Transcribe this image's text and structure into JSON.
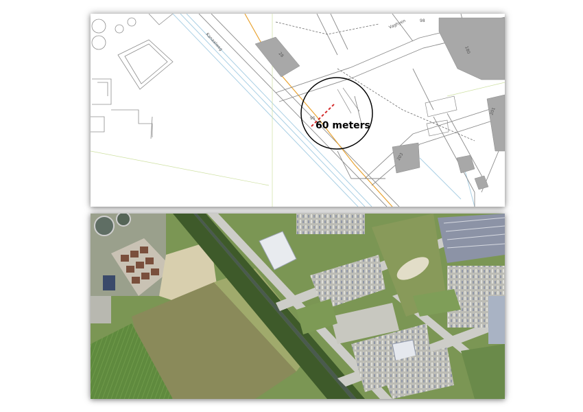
{
  "map": {
    "street_labels": {
      "kanaalweg": "Kanaalweg",
      "vaghyen": "Vaghyen"
    },
    "building_numbers": {
      "b28": "28",
      "b180": "180",
      "b201": "201",
      "b203": "203",
      "b95": "95",
      "b98": "98"
    },
    "measurement_label": "60 meters",
    "measurement_color": "#d42b2b"
  },
  "aerial": {
    "description_colors": {
      "field": "#6d8a4c",
      "road": "#c9c9c4",
      "roof": "#e8e8e8"
    }
  }
}
